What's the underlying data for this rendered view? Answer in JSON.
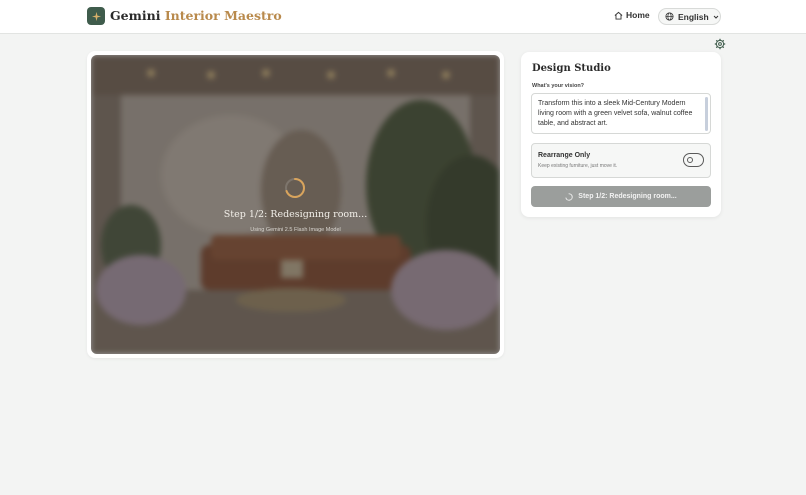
{
  "header": {
    "brand_primary": "Gemini",
    "brand_secondary": "Interior Maestro",
    "logo_icon": "sparkle-icon",
    "home_label": "Home",
    "home_icon": "home-icon",
    "language": "English",
    "language_icon": "globe-icon"
  },
  "settings": {
    "icon": "gear-icon"
  },
  "preview": {
    "loading_title": "Step 1/2: Redesigning room...",
    "loading_subtitle": "Using Gemini 2.5 Flash Image Model"
  },
  "studio": {
    "title": "Design Studio",
    "vision_label": "What's your vision?",
    "vision_text": "Transform this into a sleek Mid-Century Modern living room with a green velvet sofa, walnut coffee table, and abstract art.",
    "rearrange_title": "Rearrange Only",
    "rearrange_subtitle": "Keep existing furniture, just move it.",
    "rearrange_enabled": false,
    "submit_label": "Step 1/2: Redesigning room..."
  },
  "colors": {
    "accent_green": "#3f5c4c",
    "accent_gold": "#b98a4c",
    "button_disabled": "#9b9e9c",
    "page_background": "#f3f4f3"
  }
}
